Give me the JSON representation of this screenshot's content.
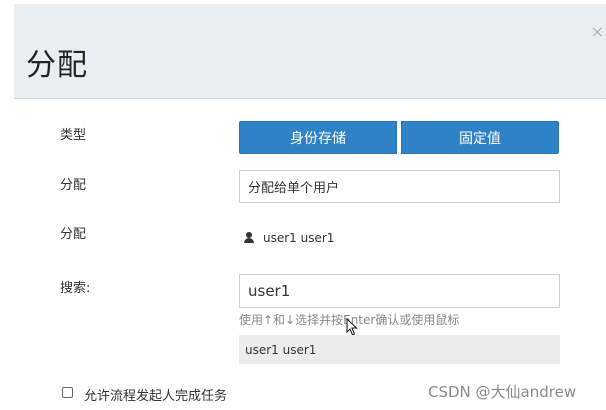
{
  "dialog": {
    "title": "分配",
    "close_glyph": "×"
  },
  "form": {
    "type_label": "类型",
    "type_options": [
      "身份存储",
      "固定值"
    ],
    "assign_label": "分配",
    "assign_value": "分配给单个用户",
    "assignee_label": "分配",
    "assignee_value": "user1 user1",
    "search_label": "搜索:",
    "search_value": "user1",
    "search_hint": "使用↑和↓选择并按Enter确认或使用鼠标",
    "search_result": "user1 user1",
    "checkbox_label": "允许流程发起人完成任务",
    "checkbox_checked": false
  },
  "watermark": "CSDN @大仙andrew",
  "colors": {
    "primary": "#2f82c6",
    "header_bg": "#e9eef4",
    "result_bg": "#ececec"
  }
}
